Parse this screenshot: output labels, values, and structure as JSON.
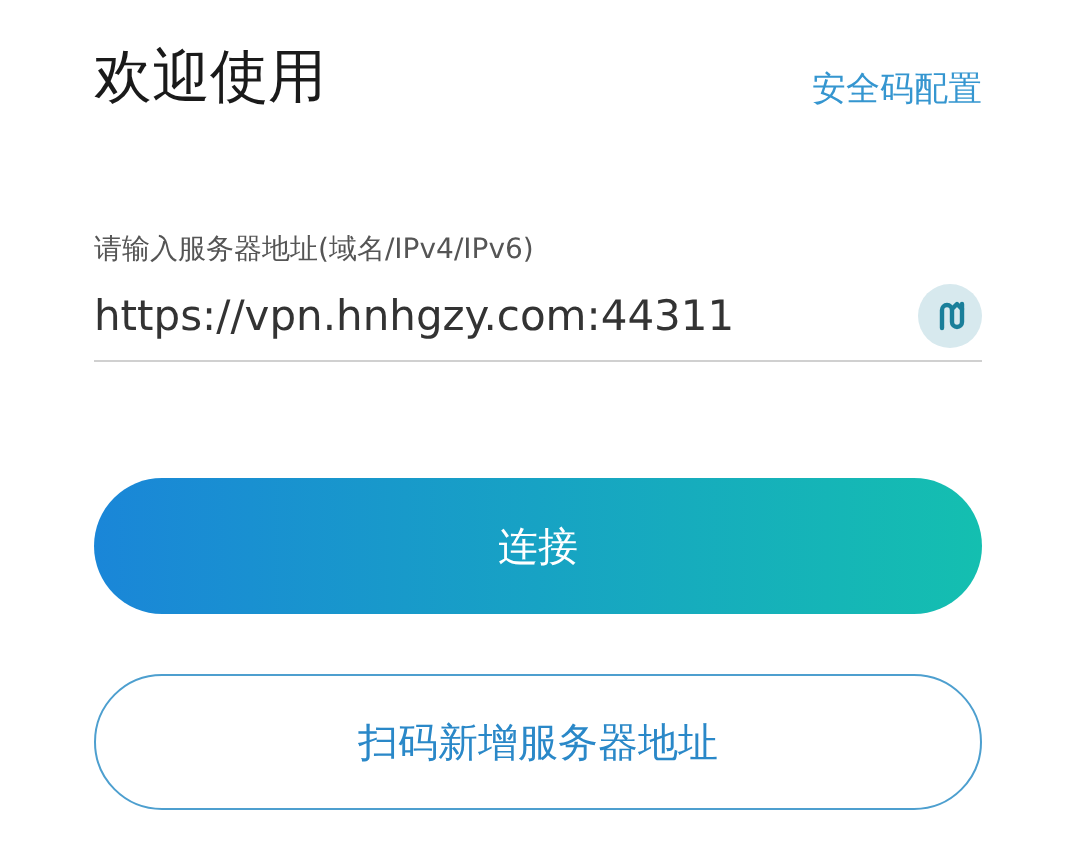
{
  "header": {
    "title": "欢迎使用",
    "link": "安全码配置"
  },
  "server_field": {
    "label": "请输入服务器地址(域名/IPv4/IPv6)",
    "value": "https://vpn.hnhgzy.com:44311"
  },
  "buttons": [
    {
      "kind": "primary",
      "label": "连接"
    },
    {
      "kind": "outline",
      "label": "扫码新增服务器地址"
    }
  ]
}
